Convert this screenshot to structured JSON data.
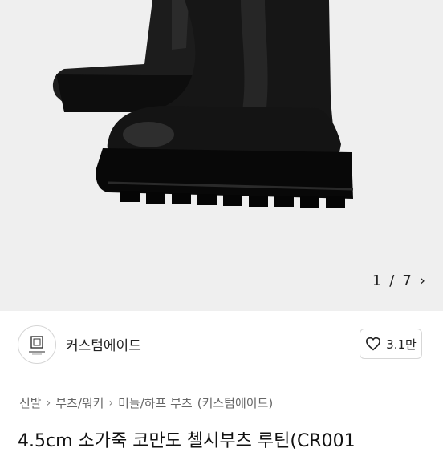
{
  "product": {
    "image_alt": "black chelsea boots",
    "pager": {
      "current": "1",
      "separator": "/",
      "total": "7",
      "next_icon": "chevron-right-icon"
    },
    "title": "4.5cm 소가죽 코만도 첼시부츠 루틴(CR001"
  },
  "store": {
    "name": "커스텀에이드",
    "like_label": "3.1만",
    "like_icon": "heart-icon"
  },
  "breadcrumb": {
    "items": [
      "신발",
      "부츠/워커",
      "미들/하프 부츠",
      "(커스텀에이드)"
    ],
    "separator_icon": "chevron-right-icon"
  },
  "colors": {
    "hero_bg": "#efefef",
    "text": "#222222",
    "muted": "#666666"
  }
}
